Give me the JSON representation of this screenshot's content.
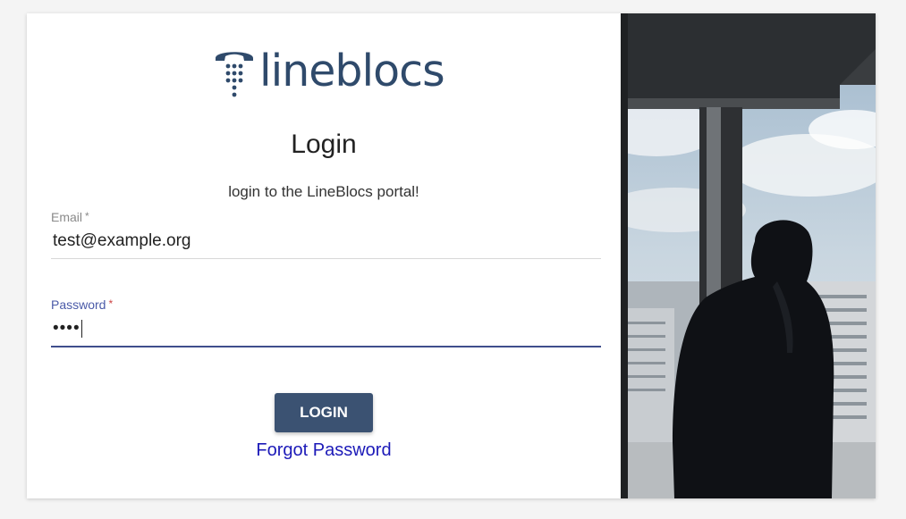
{
  "brand": {
    "name": "lineblocs",
    "color": "#2f4a6b"
  },
  "login": {
    "title": "Login",
    "subtitle": "login to the LineBlocs portal!",
    "email": {
      "label": "Email",
      "required_mark": "*",
      "value": "test@example.org"
    },
    "password": {
      "label": "Password",
      "required_mark": "*",
      "masked_value": "••••"
    },
    "submit_label": "LOGIN",
    "forgot_label": "Forgot Password"
  },
  "colors": {
    "button": "#3b5272",
    "focus": "#3f4e8c",
    "link": "#1c1ab8"
  }
}
